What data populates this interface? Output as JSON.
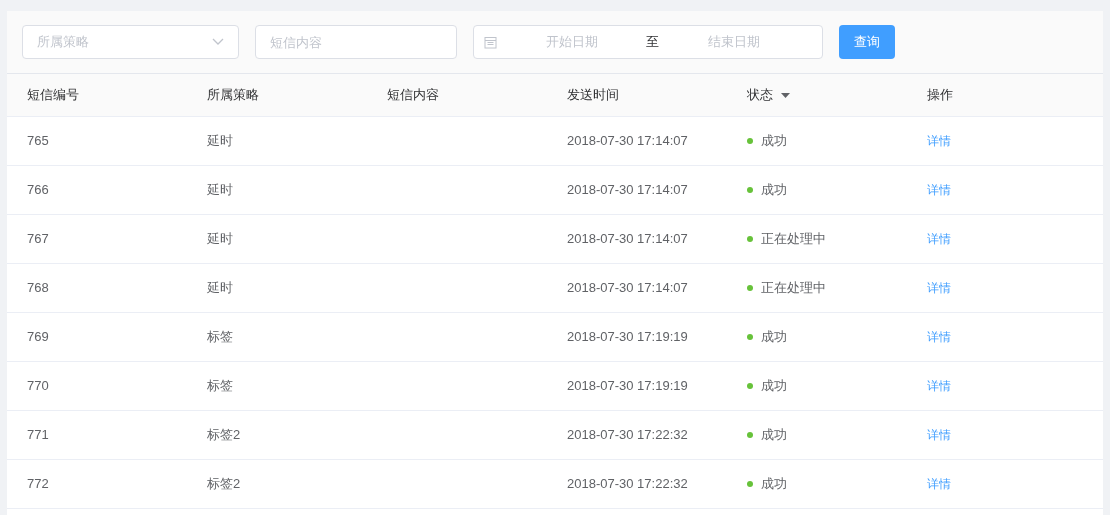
{
  "filters": {
    "strategy_select": {
      "placeholder": "所属策略"
    },
    "content_field": {
      "placeholder": "短信内容"
    },
    "date_range": {
      "start_placeholder": "开始日期",
      "separator": "至",
      "end_placeholder": "结束日期"
    },
    "query_button": "查询"
  },
  "table": {
    "columns": [
      {
        "label": "短信编号",
        "sortable": false
      },
      {
        "label": "所属策略",
        "sortable": false
      },
      {
        "label": "短信内容",
        "sortable": false
      },
      {
        "label": "发送时间",
        "sortable": false
      },
      {
        "label": "状态",
        "sortable": true
      },
      {
        "label": "操作",
        "sortable": false
      }
    ],
    "rows": [
      {
        "id": "765",
        "strategy": "延时",
        "time": "2018-07-30 17:14:07",
        "status": "成功",
        "color": "#67c23a",
        "action": "详情"
      },
      {
        "id": "766",
        "strategy": "延时",
        "time": "2018-07-30 17:14:07",
        "status": "成功",
        "color": "#67c23a",
        "action": "详情"
      },
      {
        "id": "767",
        "strategy": "延时",
        "time": "2018-07-30 17:14:07",
        "status": "正在处理中",
        "color": "#67c23a",
        "action": "详情"
      },
      {
        "id": "768",
        "strategy": "延时",
        "time": "2018-07-30 17:14:07",
        "status": "正在处理中",
        "color": "#67c23a",
        "action": "详情"
      },
      {
        "id": "769",
        "strategy": "标签",
        "time": "2018-07-30 17:19:19",
        "status": "成功",
        "color": "#67c23a",
        "action": "详情"
      },
      {
        "id": "770",
        "strategy": "标签",
        "time": "2018-07-30 17:19:19",
        "status": "成功",
        "color": "#67c23a",
        "action": "详情"
      },
      {
        "id": "771",
        "strategy": "标签2",
        "time": "2018-07-30 17:22:32",
        "status": "成功",
        "color": "#67c23a",
        "action": "详情"
      },
      {
        "id": "772",
        "strategy": "标签2",
        "time": "2018-07-30 17:22:32",
        "status": "成功",
        "color": "#67c23a",
        "action": "详情"
      }
    ]
  }
}
